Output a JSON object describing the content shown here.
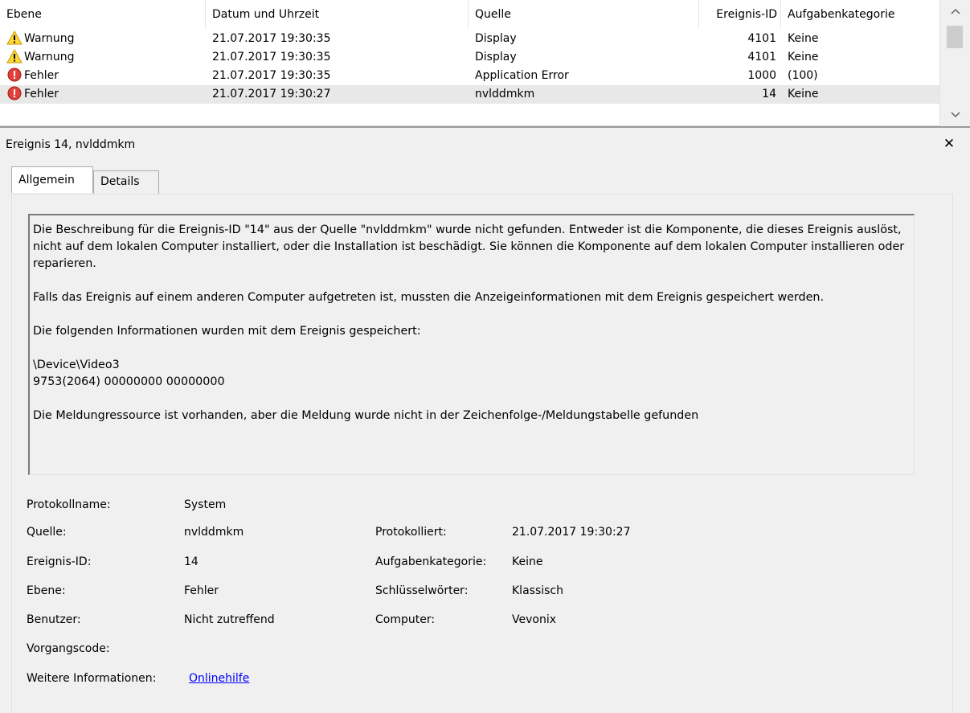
{
  "list": {
    "columns": [
      "Ebene",
      "Datum und Uhrzeit",
      "Quelle",
      "Ereignis-ID",
      "Aufgabenkategorie"
    ],
    "rows": [
      {
        "level": "Warnung",
        "level_icon": "warning-icon",
        "date": "21.07.2017 19:30:35",
        "source": "Display",
        "id": "4101",
        "category": "Keine"
      },
      {
        "level": "Warnung",
        "level_icon": "warning-icon",
        "date": "21.07.2017 19:30:35",
        "source": "Display",
        "id": "4101",
        "category": "Keine"
      },
      {
        "level": "Fehler",
        "level_icon": "error-icon",
        "date": "21.07.2017 19:30:35",
        "source": "Application Error",
        "id": "1000",
        "category": "(100)"
      },
      {
        "level": "Fehler",
        "level_icon": "error-icon",
        "date": "21.07.2017 19:30:27",
        "source": "nvlddmkm",
        "id": "14",
        "category": "Keine",
        "selected": true
      }
    ]
  },
  "detail": {
    "title": "Ereignis 14, nvlddmkm",
    "close_icon": "close-icon",
    "tabs": {
      "general": "Allgemein",
      "details": "Details"
    },
    "description": {
      "p1": "Die Beschreibung für die Ereignis-ID \"14\" aus der Quelle \"nvlddmkm\" wurde nicht gefunden. Entweder ist die Komponente, die dieses Ereignis auslöst, nicht auf dem lokalen Computer installiert, oder die Installation ist beschädigt. Sie können die Komponente auf dem lokalen Computer installieren oder reparieren.",
      "p2": "Falls das Ereignis auf einem anderen Computer aufgetreten ist, mussten die Anzeigeinformationen mit dem Ereignis gespeichert werden.",
      "p3": "Die folgenden Informationen wurden mit dem Ereignis gespeichert:",
      "p4a": "\\Device\\Video3",
      "p4b": "9753(2064) 00000000 00000000",
      "p5": "Die Meldungressource ist vorhanden, aber die Meldung wurde nicht in der Zeichenfolge-/Meldungstabelle gefunden"
    },
    "props": {
      "protokollname_label": "Protokollname:",
      "protokollname": "System",
      "quelle_label": "Quelle:",
      "quelle": "nvlddmkm",
      "protokolliert_label": "Protokolliert:",
      "protokolliert": "21.07.2017 19:30:27",
      "ereignis_id_label": "Ereignis-ID:",
      "ereignis_id": "14",
      "aufgabenkategorie_label": "Aufgabenkategorie:",
      "aufgabenkategorie": "Keine",
      "ebene_label": "Ebene:",
      "ebene": "Fehler",
      "schluesselwoerter_label": "Schlüsselwörter:",
      "schluesselwoerter": "Klassisch",
      "benutzer_label": "Benutzer:",
      "benutzer": "Nicht zutreffend",
      "computer_label": "Computer:",
      "computer": "Vevonix",
      "vorgangscode_label": "Vorgangscode:",
      "weitere_label": "Weitere Informationen:",
      "weitere_link": "Onlinehilfe"
    }
  }
}
